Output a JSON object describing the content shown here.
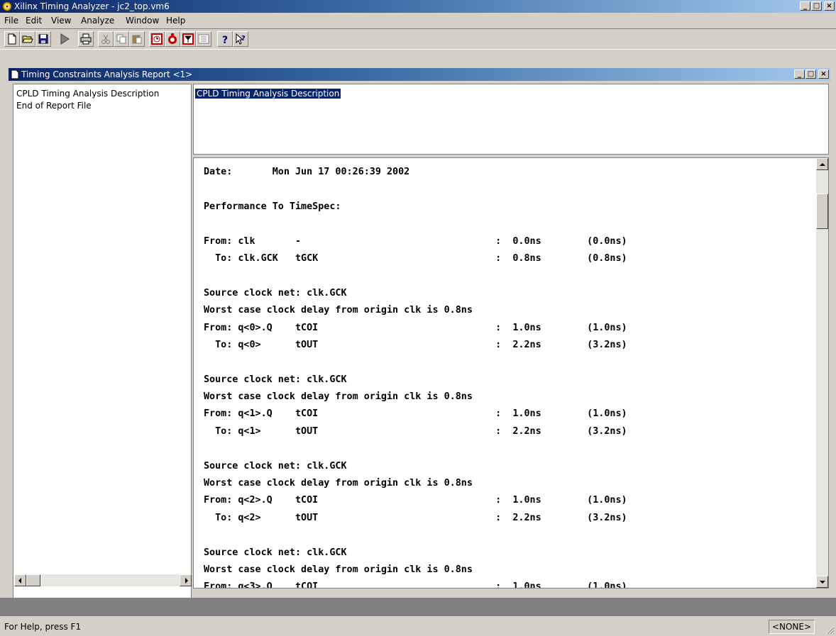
{
  "app": {
    "title": "Xilinx Timing Analyzer - jc2_top.vm6",
    "window_buttons": [
      "_",
      "□",
      "×"
    ]
  },
  "menu": [
    "File",
    "Edit",
    "View",
    "Analyze",
    "Window",
    "Help"
  ],
  "toolbar": {
    "icons": [
      "new-icon",
      "open-icon",
      "save-icon",
      "run-icon",
      "print-icon",
      "cut-icon",
      "copy-icon",
      "paste-icon",
      "timing-icon",
      "stop-icon",
      "filter-icon",
      "options-icon",
      "help-icon",
      "context-help-icon"
    ]
  },
  "child": {
    "title": "Timing Constraints Analysis Report <1>"
  },
  "tree": {
    "items": [
      "CPLD Timing Analysis Description",
      "End of Report File"
    ]
  },
  "description": {
    "selected_text": "CPLD Timing Analysis Description"
  },
  "report": {
    "lines": [
      "Date:       Mon Jun 17 00:26:39 2002",
      "",
      "Performance To TimeSpec:",
      "",
      "From: clk       -                                  :  0.0ns        (0.0ns)",
      "  To: clk.GCK   tGCK                               :  0.8ns        (0.8ns)",
      "",
      "Source clock net: clk.GCK",
      "Worst case clock delay from origin clk is 0.8ns",
      "From: q<0>.Q    tCOI                               :  1.0ns        (1.0ns)",
      "  To: q<0>      tOUT                               :  2.2ns        (3.2ns)",
      "",
      "Source clock net: clk.GCK",
      "Worst case clock delay from origin clk is 0.8ns",
      "From: q<1>.Q    tCOI                               :  1.0ns        (1.0ns)",
      "  To: q<1>      tOUT                               :  2.2ns        (3.2ns)",
      "",
      "Source clock net: clk.GCK",
      "Worst case clock delay from origin clk is 0.8ns",
      "From: q<2>.Q    tCOI                               :  1.0ns        (1.0ns)",
      "  To: q<2>      tOUT                               :  2.2ns        (3.2ns)",
      "",
      "Source clock net: clk.GCK",
      "Worst case clock delay from origin clk is 0.8ns",
      "From: q<3>.Q    tCOI                               :  1.0ns        (1.0ns)"
    ]
  },
  "status": {
    "help_text": "For Help, press F1",
    "panel_text": "<NONE>"
  },
  "colors": {
    "titlebar_start": "#0a246a",
    "titlebar_end": "#a6caf0",
    "face": "#d4d0c8",
    "selection": "#0a246a"
  }
}
